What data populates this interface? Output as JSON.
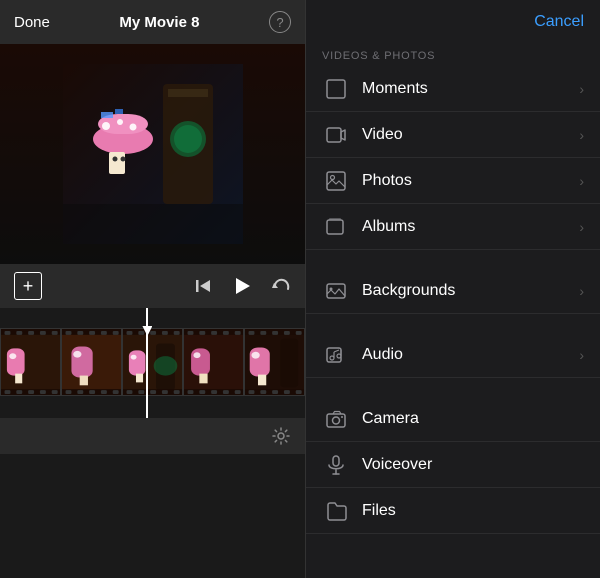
{
  "header": {
    "done_label": "Done",
    "title": "My Movie 8",
    "help_label": "?",
    "cancel_label": "Cancel"
  },
  "controls": {
    "add_label": "+",
    "settings_label": "⚙"
  },
  "section": {
    "videos_photos_label": "VIDEOS & PHOTOS"
  },
  "menu_items": [
    {
      "id": "moments",
      "label": "Moments",
      "icon": "square",
      "has_chevron": true
    },
    {
      "id": "video",
      "label": "Video",
      "icon": "film",
      "has_chevron": true
    },
    {
      "id": "photos",
      "label": "Photos",
      "icon": "square",
      "has_chevron": true
    },
    {
      "id": "albums",
      "label": "Albums",
      "icon": "square",
      "has_chevron": true
    },
    {
      "id": "backgrounds",
      "label": "Backgrounds",
      "icon": "image",
      "has_chevron": true
    },
    {
      "id": "audio",
      "label": "Audio",
      "icon": "music",
      "has_chevron": true
    },
    {
      "id": "camera",
      "label": "Camera",
      "icon": "camera",
      "has_chevron": false
    },
    {
      "id": "voiceover",
      "label": "Voiceover",
      "icon": "mic",
      "has_chevron": false
    },
    {
      "id": "files",
      "label": "Files",
      "icon": "folder",
      "has_chevron": false
    }
  ],
  "colors": {
    "accent": "#3b9eff",
    "text_primary": "#ffffff",
    "text_secondary": "#8e8e93",
    "bg_dark": "#1c1c1e",
    "bg_panel": "#2a2a2a",
    "separator": "#2c2c2e"
  }
}
